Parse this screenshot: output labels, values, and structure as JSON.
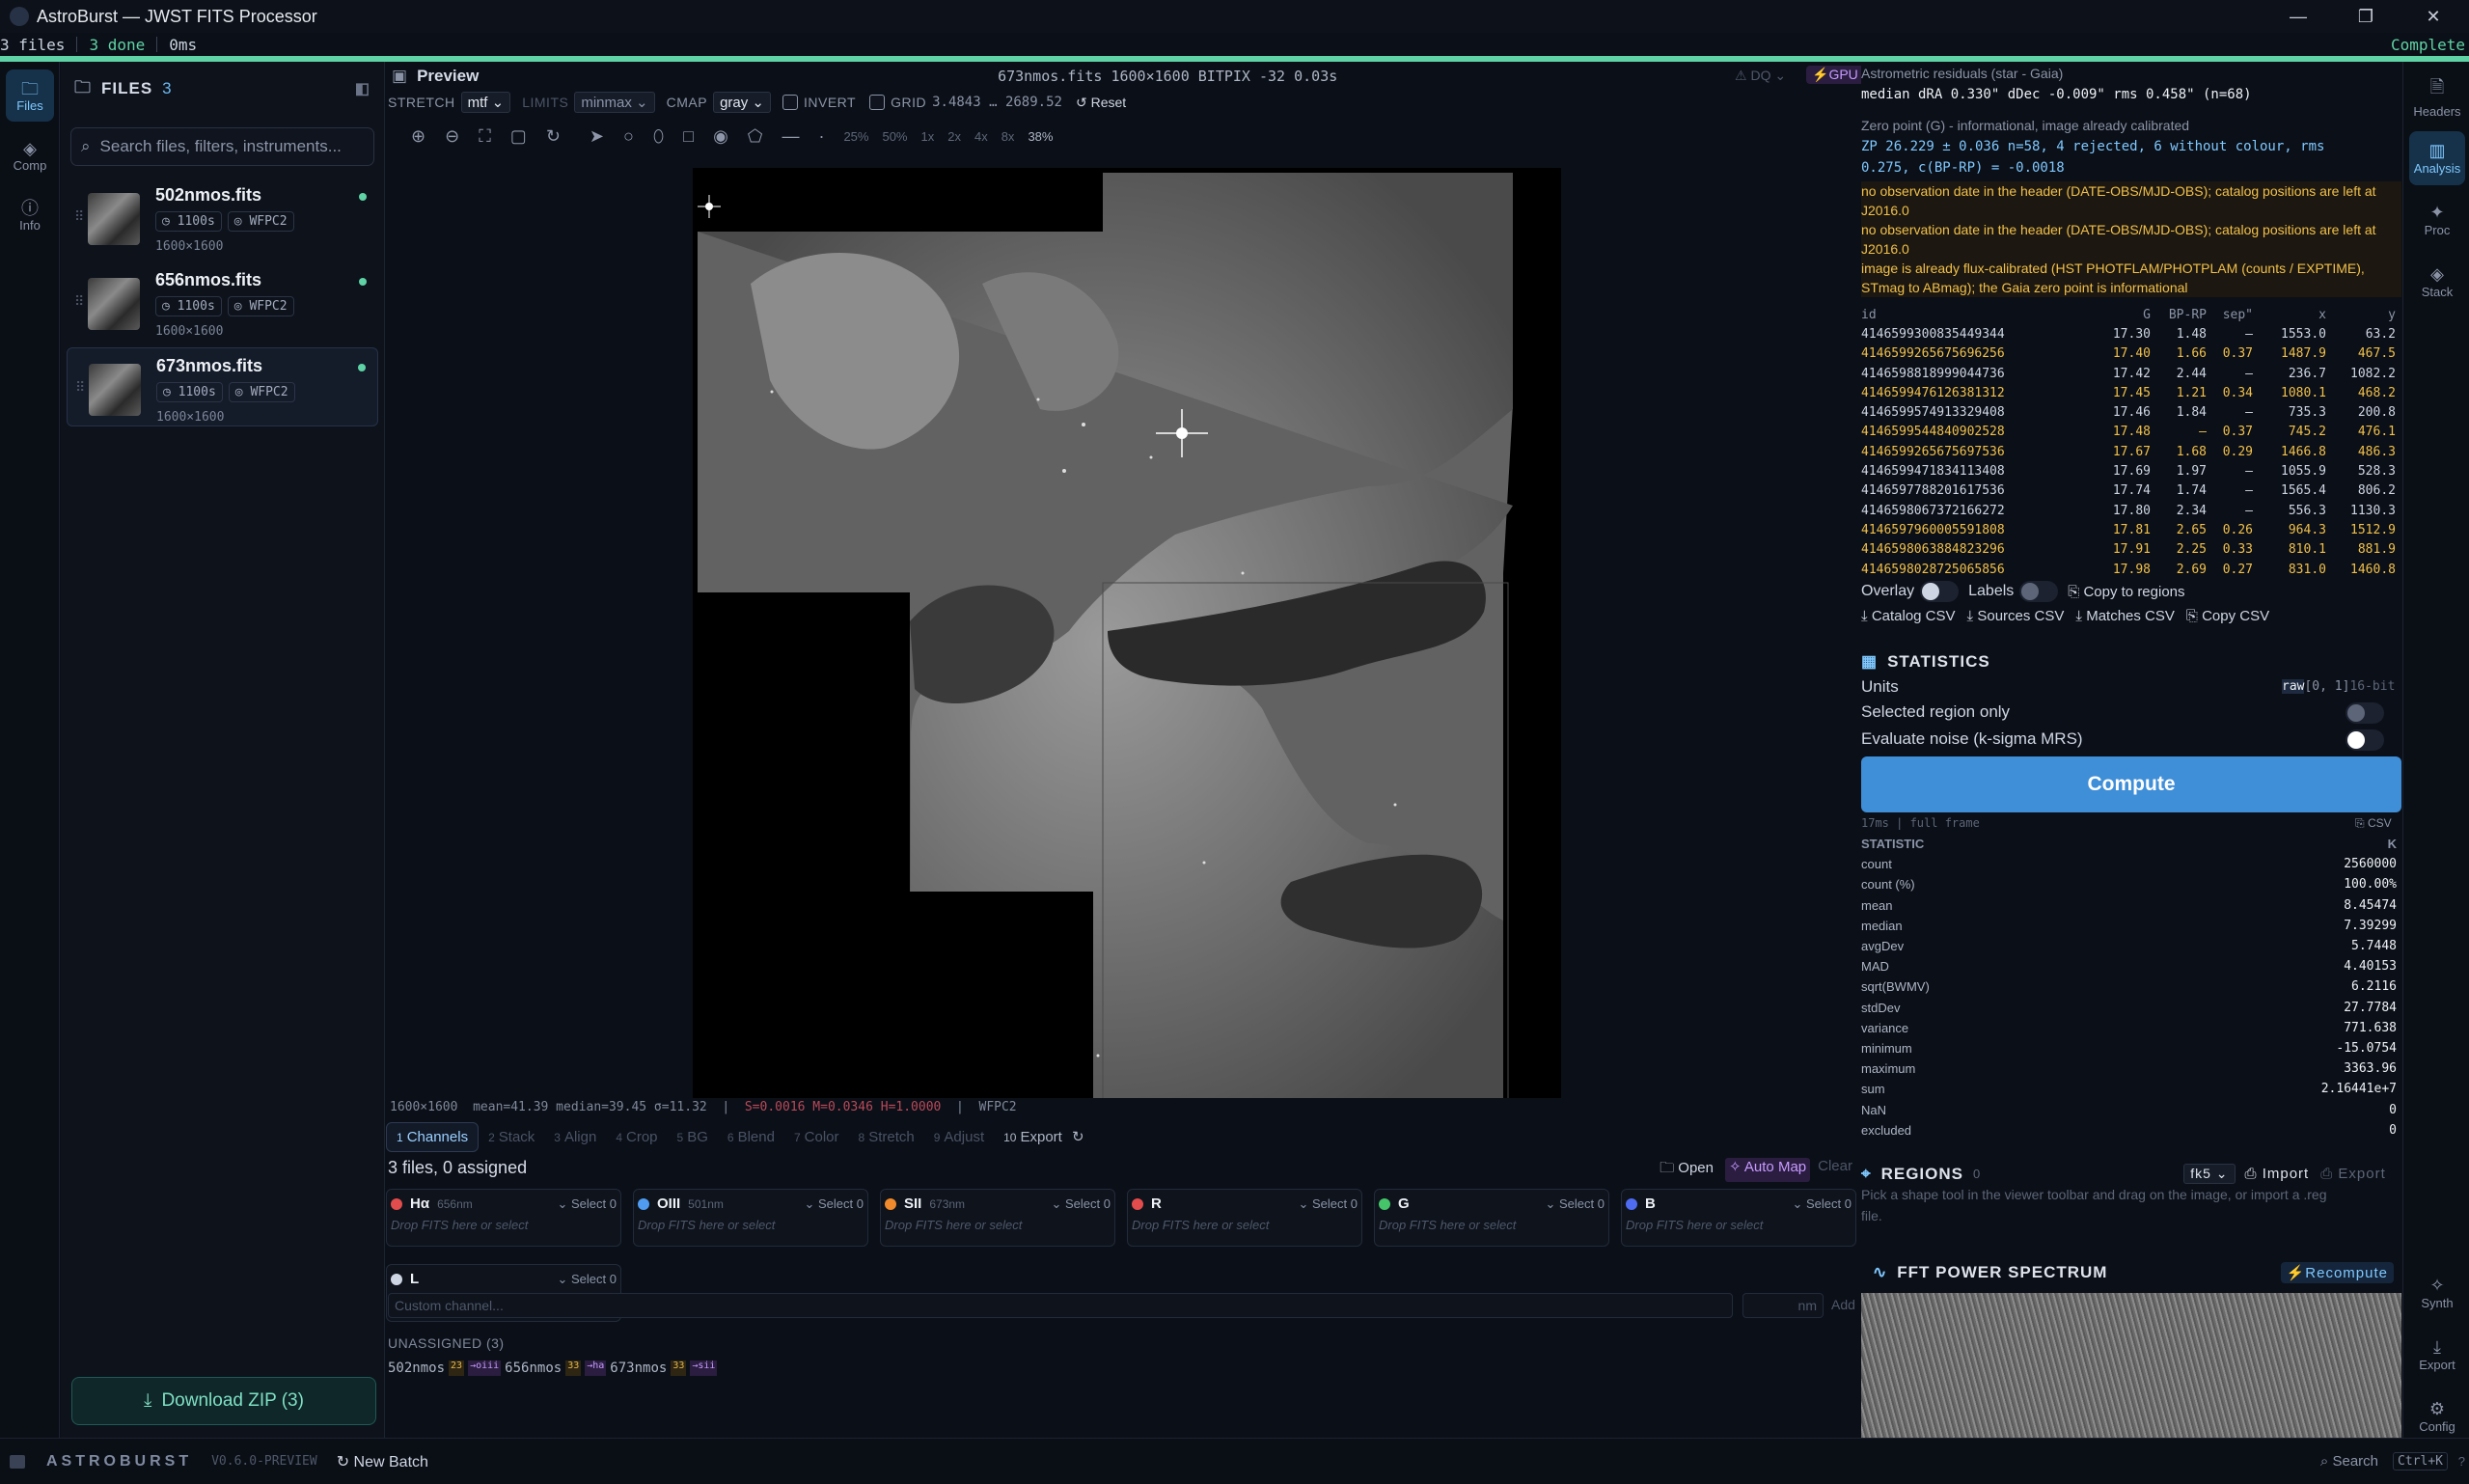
{
  "window": {
    "title": "AstroBurst — JWST FITS Processor",
    "min": "—",
    "max": "❐",
    "close": "✕"
  },
  "status": {
    "files": "3 files",
    "done": "3 done",
    "time": "0ms",
    "state": "Complete",
    "progress": 1.0
  },
  "rail": {
    "items": [
      {
        "label": "Files",
        "icon": "folder-icon"
      },
      {
        "label": "Comp",
        "icon": "layers-icon"
      },
      {
        "label": "Info",
        "icon": "info-icon"
      }
    ]
  },
  "files": {
    "header": "FILES",
    "count": "3",
    "search_placeholder": "Search files, filters, instruments...",
    "items": [
      {
        "name": "502nmos.fits",
        "exp": "1100s",
        "inst": "WFPC2",
        "dims": "1600×1600"
      },
      {
        "name": "656nmos.fits",
        "exp": "1100s",
        "inst": "WFPC2",
        "dims": "1600×1600"
      },
      {
        "name": "673nmos.fits",
        "exp": "1100s",
        "inst": "WFPC2",
        "dims": "1600×1600"
      }
    ],
    "download": "Download ZIP (3)"
  },
  "preview": {
    "title": "Preview",
    "meta": "673nmos.fits  1600×1600  BITPIX -32  0.03s",
    "dq": "DQ",
    "gpu": "GPU",
    "stretch_label": "STRETCH",
    "stretch": "mtf",
    "limits_label": "LIMITS",
    "limits": "minmax",
    "cmap_label": "CMAP",
    "cmap": "gray",
    "invert": "INVERT",
    "grid": "GRID",
    "range": "3.4843 … 2689.52",
    "reset": "Reset",
    "zooms": [
      "25%",
      "50%",
      "1x",
      "2x",
      "4x",
      "8x"
    ],
    "zoom_current": "38%",
    "info_a": "1600×1600  mean=41.39 median=39.45 σ=11.32  |  ",
    "info_b": "S=0.0016 M=0.0346 H=1.0000",
    "info_c": "  |  WFPC2"
  },
  "pipeline": {
    "tabs": [
      {
        "n": "1",
        "label": "Channels"
      },
      {
        "n": "2",
        "label": "Stack"
      },
      {
        "n": "3",
        "label": "Align"
      },
      {
        "n": "4",
        "label": "Crop"
      },
      {
        "n": "5",
        "label": "BG"
      },
      {
        "n": "6",
        "label": "Blend"
      },
      {
        "n": "7",
        "label": "Color"
      },
      {
        "n": "8",
        "label": "Stretch"
      },
      {
        "n": "9",
        "label": "Adjust"
      },
      {
        "n": "10",
        "label": "Export"
      }
    ],
    "assigned": "3 files, 0 assigned",
    "open": "Open",
    "automap": "Auto Map",
    "clear": "Clear",
    "channels": [
      {
        "name": "Hα",
        "wl": "656nm",
        "color": "#e24c4c"
      },
      {
        "name": "OIII",
        "wl": "501nm",
        "color": "#4f9cf0"
      },
      {
        "name": "SII",
        "wl": "673nm",
        "color": "#f08a2c"
      },
      {
        "name": "R",
        "wl": "",
        "color": "#e24c4c"
      },
      {
        "name": "G",
        "wl": "",
        "color": "#45c46a"
      },
      {
        "name": "B",
        "wl": "",
        "color": "#4f6cf0"
      },
      {
        "name": "L",
        "wl": "",
        "color": "#cfd6e3"
      }
    ],
    "select": "Select",
    "select_count": "0",
    "drop": "Drop FITS here or select",
    "custom_placeholder": "Custom channel...",
    "nm_placeholder": "nm",
    "add": "Add",
    "unassigned_label": "UNASSIGNED (3)",
    "unassigned": [
      {
        "name": "502nmos",
        "t": "23",
        "h": "→oiii"
      },
      {
        "name": "656nmos",
        "t": "33",
        "h": "→ha"
      },
      {
        "name": "673nmos",
        "t": "33",
        "h": "→sii"
      }
    ]
  },
  "astrometry": {
    "header": "Astrometric residuals (star - Gaia)",
    "median": "median dRA 0.330\" dDec -0.009\" rms 0.458\" (n=68)",
    "zp_title": "Zero point (G) - informational, image already calibrated",
    "zp1": "ZP 26.229 ± 0.036 n=58, 4 rejected, 6 without colour, rms",
    "zp2": "0.275, c(BP-RP) = -0.0018",
    "warnings": [
      [
        "no observation date in the header (DATE-OBS/MJD-OBS); catalog positions are left at",
        "J2016.0"
      ],
      [
        "no observation date in the header (DATE-OBS/MJD-OBS); catalog positions are left at",
        "J2016.0"
      ],
      [
        "image is already flux-calibrated (HST PHOTFLAM/PHOTPLAM (counts / EXPTIME),",
        "STmag to ABmag); the Gaia zero point is informational"
      ]
    ],
    "columns": [
      "id",
      "G",
      "BP-RP",
      "sep\"",
      "x",
      "y"
    ],
    "rows": [
      [
        "4146599300835449344",
        "17.30",
        "1.48",
        "—",
        "1553.0",
        "63.2",
        "w"
      ],
      [
        "4146599265675696256",
        "17.40",
        "1.66",
        "0.37",
        "1487.9",
        "467.5",
        "y"
      ],
      [
        "4146598818999044736",
        "17.42",
        "2.44",
        "—",
        "236.7",
        "1082.2",
        "w"
      ],
      [
        "4146599476126381312",
        "17.45",
        "1.21",
        "0.34",
        "1080.1",
        "468.2",
        "y"
      ],
      [
        "4146599574913329408",
        "17.46",
        "1.84",
        "—",
        "735.3",
        "200.8",
        "w"
      ],
      [
        "4146599544840902528",
        "17.48",
        "—",
        "0.37",
        "745.2",
        "476.1",
        "y"
      ],
      [
        "4146599265675697536",
        "17.67",
        "1.68",
        "0.29",
        "1466.8",
        "486.3",
        "y"
      ],
      [
        "4146599471834113408",
        "17.69",
        "1.97",
        "—",
        "1055.9",
        "528.3",
        "w"
      ],
      [
        "4146597788201617536",
        "17.74",
        "1.74",
        "—",
        "1565.4",
        "806.2",
        "w"
      ],
      [
        "4146598067372166272",
        "17.80",
        "2.34",
        "—",
        "556.3",
        "1130.3",
        "w"
      ],
      [
        "4146597960005591808",
        "17.81",
        "2.65",
        "0.26",
        "964.3",
        "1512.9",
        "y"
      ],
      [
        "4146598063884823296",
        "17.91",
        "2.25",
        "0.33",
        "810.1",
        "881.9",
        "y"
      ],
      [
        "4146598028725065856",
        "17.98",
        "2.69",
        "0.27",
        "831.0",
        "1460.8",
        "y"
      ]
    ],
    "overlay": "Overlay",
    "labels": "Labels",
    "copy_regions": "Copy to regions",
    "buttons": [
      "Catalog CSV",
      "Sources CSV",
      "Matches CSV",
      "Copy CSV"
    ]
  },
  "statistics": {
    "header": "STATISTICS",
    "units": "Units",
    "units_raw": "raw",
    "units_range": "[0, 1]",
    "units_bit": "16-bit",
    "region_only": "Selected region only",
    "noise": "Evaluate noise (k-sigma MRS)",
    "compute": "Compute",
    "timing": "17ms | full frame",
    "csv": "CSV",
    "col_stat": "STATISTIC",
    "col_k": "K",
    "rows": [
      [
        "count",
        "2560000"
      ],
      [
        "count (%)",
        "100.00%"
      ],
      [
        "mean",
        "8.45474"
      ],
      [
        "median",
        "7.39299"
      ],
      [
        "avgDev",
        "5.7448"
      ],
      [
        "MAD",
        "4.40153"
      ],
      [
        "sqrt(BWMV)",
        "6.2116"
      ],
      [
        "stdDev",
        "27.7784"
      ],
      [
        "variance",
        "771.638"
      ],
      [
        "minimum",
        "-15.0754"
      ],
      [
        "maximum",
        "3363.96"
      ],
      [
        "sum",
        "2.16441e+7"
      ],
      [
        "NaN",
        "0"
      ],
      [
        "excluded",
        "0"
      ]
    ]
  },
  "regions": {
    "header": "REGIONS",
    "count": "0",
    "frame": "fk5",
    "import": "Import",
    "export": "Export",
    "hint1": "Pick a shape tool in the viewer toolbar and drag on the image, or import a .reg",
    "hint2": "file."
  },
  "fft": {
    "header": "FFT POWER SPECTRUM",
    "recompute": "Recompute"
  },
  "rrail": {
    "top": [
      {
        "label": "Headers"
      },
      {
        "label": "Analysis"
      },
      {
        "label": "Proc"
      },
      {
        "label": "Stack"
      }
    ],
    "bottom": [
      {
        "label": "Synth"
      },
      {
        "label": "Export"
      },
      {
        "label": "Config"
      }
    ]
  },
  "footer": {
    "brand": "ASTROBURST",
    "version": "V0.6.0-PREVIEW",
    "new_batch": "New Batch",
    "search": "Search",
    "kbd": "Ctrl+K",
    "help": "?"
  }
}
